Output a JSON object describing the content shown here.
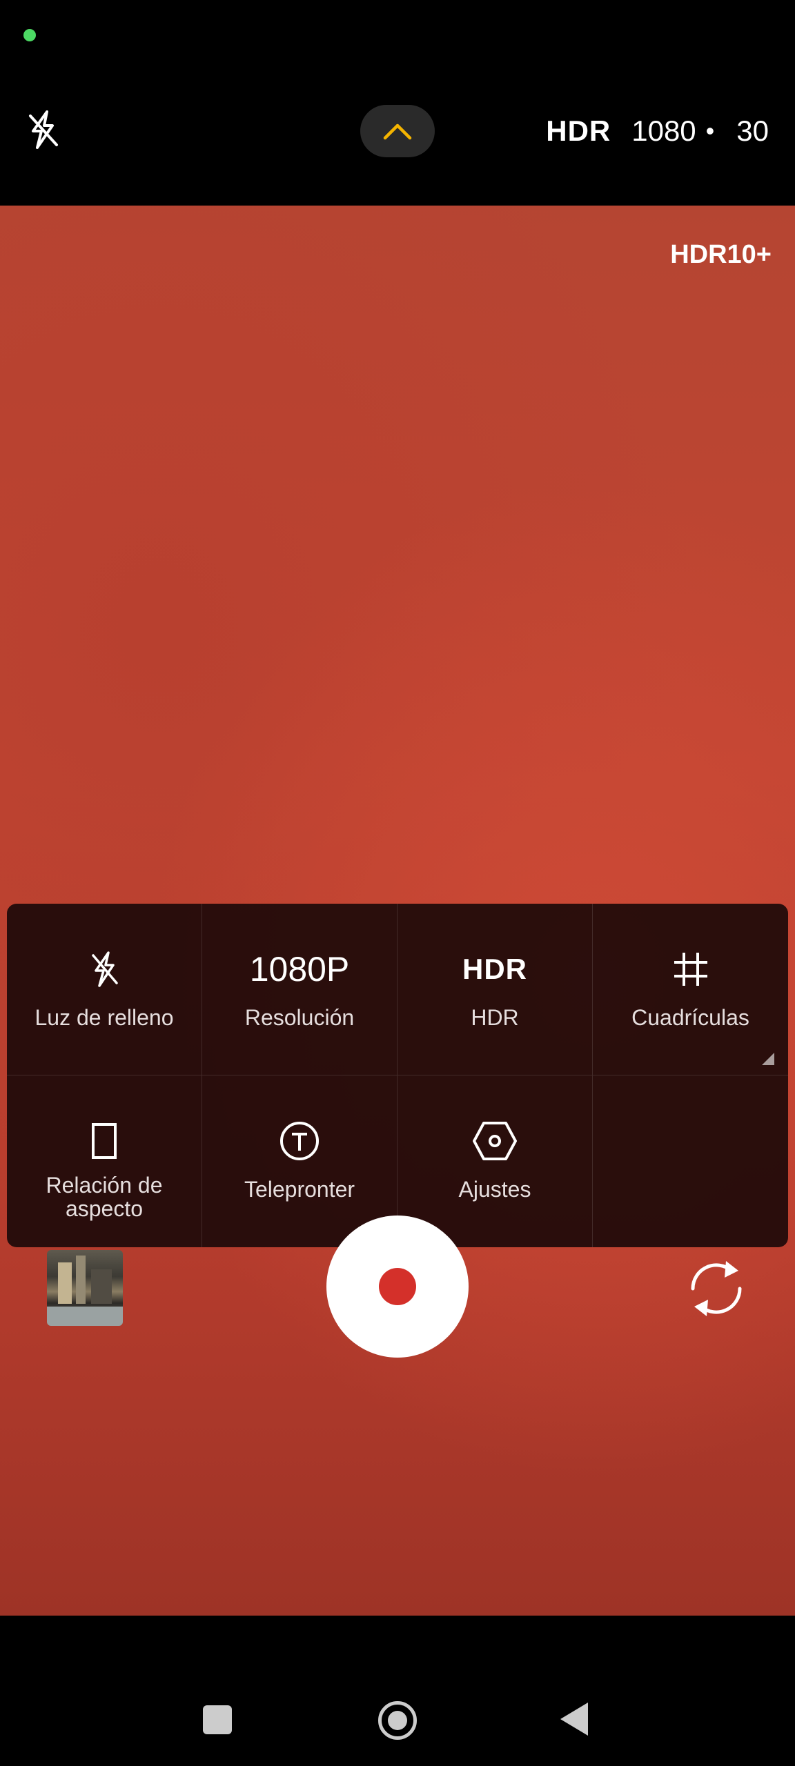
{
  "top_bar": {
    "flash_icon": "flash-off-icon",
    "expand_icon": "chevron-up-icon",
    "hdr_label": "HDR",
    "resolution": "1080",
    "separator": "•",
    "fps": "30"
  },
  "viewfinder": {
    "badge": "HDR10+"
  },
  "panel": {
    "items": [
      {
        "label": "Luz de relleno",
        "icon": "flash-off-icon"
      },
      {
        "label": "Resolución",
        "value": "1080P"
      },
      {
        "label": "HDR",
        "value": "HDR"
      },
      {
        "label": "Cuadrículas",
        "icon": "grid-icon"
      },
      {
        "label": "Relación de aspecto",
        "icon": "aspect-ratio-icon"
      },
      {
        "label": "Telepronter",
        "icon": "teleprompter-icon"
      },
      {
        "label": "Ajustes",
        "icon": "settings-hexagon-icon"
      }
    ]
  },
  "bottom": {
    "gallery_icon": "gallery-thumbnail",
    "record_icon": "record-icon",
    "switch_icon": "switch-camera-icon"
  },
  "colors": {
    "accent_chevron": "#f4b400",
    "record_red": "#d4302a"
  }
}
